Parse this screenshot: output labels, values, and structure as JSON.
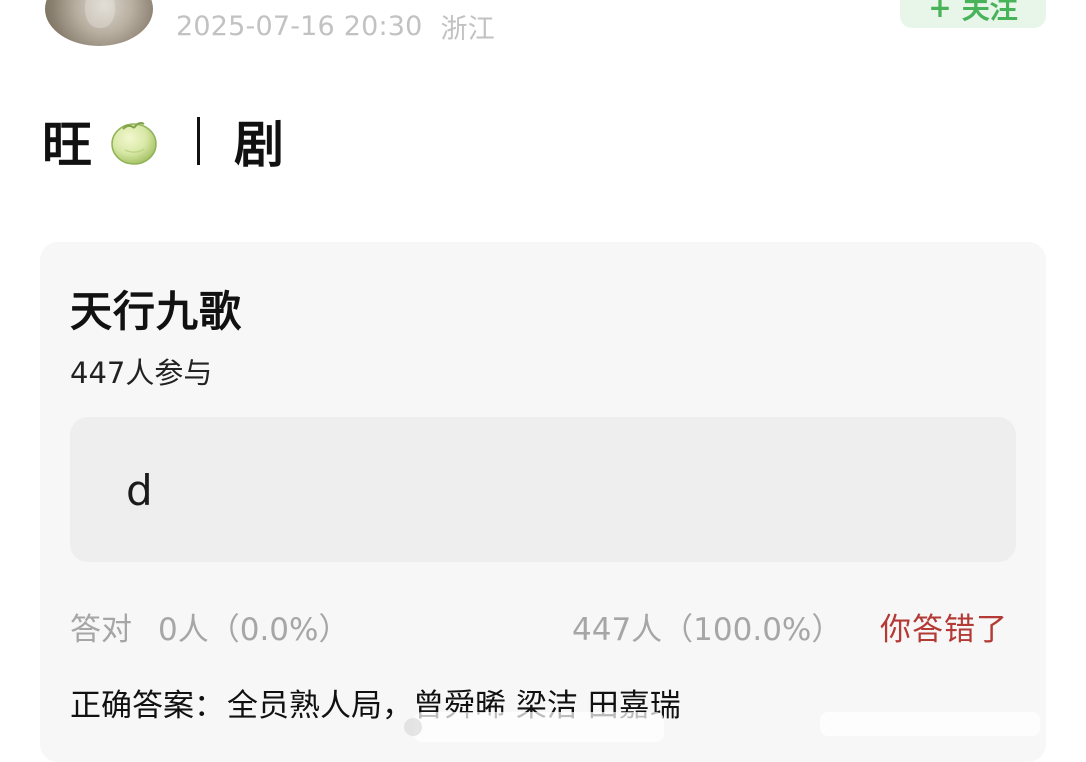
{
  "header": {
    "timestamp": "2025-07-16 20:30",
    "location": "浙江",
    "follow_label": "关注",
    "follow_icon": "plus-icon"
  },
  "post": {
    "title_left": "旺",
    "title_right": "剧",
    "melon_icon": "melon-icon"
  },
  "quiz": {
    "title": "天行九歌",
    "participants": "447人参与",
    "option": "d",
    "correct_label": "答对",
    "correct_stats": "0人（0.0%）",
    "wrong_stats": "447人（100.0%）",
    "result_notice": "你答错了",
    "answer_label": "正确答案：",
    "answer_value": "全员熟人局，曾舜晞 梁洁 田嘉瑞"
  },
  "colors": {
    "card_bg": "#f7f7f7",
    "option_bg": "#eeeeee",
    "muted_text": "#a6a6a6",
    "error_text": "#b43a35",
    "follow_green": "#49b35a"
  }
}
